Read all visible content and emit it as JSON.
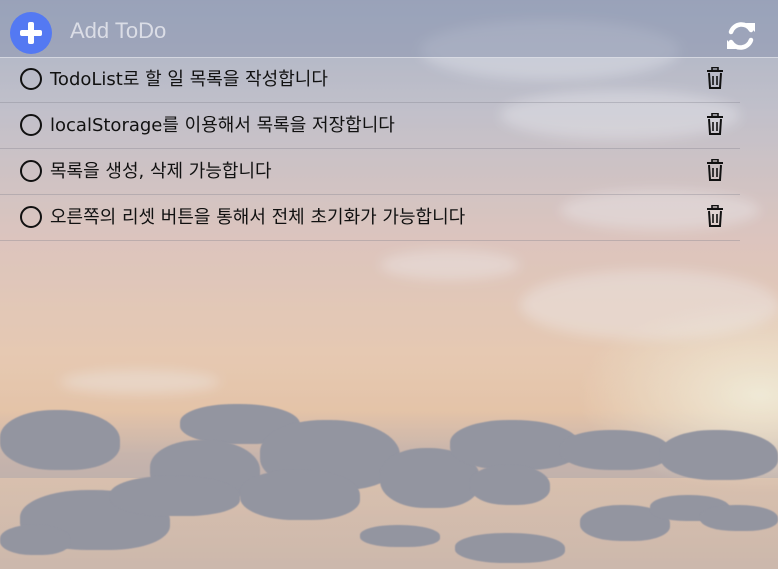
{
  "header": {
    "add_placeholder": "Add ToDo",
    "add_icon": "plus-icon",
    "reset_icon": "refresh-icon",
    "accent_color": "#5479f2"
  },
  "todos": [
    {
      "text": "TodoList로 할 일 목록을 작성합니다",
      "done": false
    },
    {
      "text": "localStorage를 이용해서 목록을 저장합니다",
      "done": false
    },
    {
      "text": "목록을 생성, 삭제 가능합니다",
      "done": false
    },
    {
      "text": "오른쪽의 리셋 버튼을 통해서 전체 초기화가 가능합니다",
      "done": false
    }
  ],
  "icons": {
    "check": "circle-check-icon",
    "delete": "trash-icon"
  }
}
